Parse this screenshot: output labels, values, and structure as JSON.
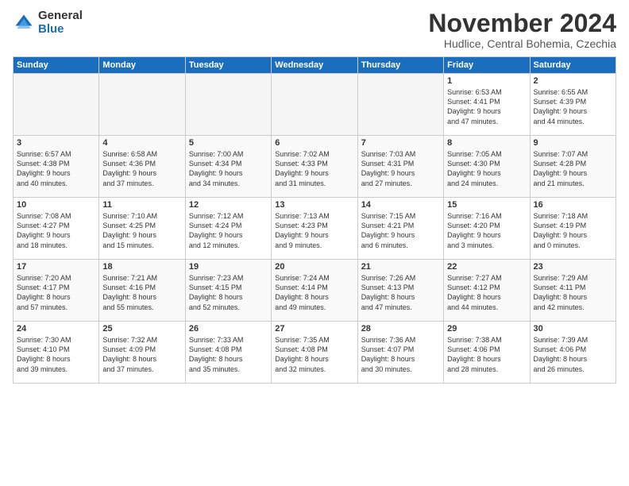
{
  "logo": {
    "general": "General",
    "blue": "Blue"
  },
  "title": "November 2024",
  "subtitle": "Hudlice, Central Bohemia, Czechia",
  "days_header": [
    "Sunday",
    "Monday",
    "Tuesday",
    "Wednesday",
    "Thursday",
    "Friday",
    "Saturday"
  ],
  "weeks": [
    [
      {
        "day": "",
        "info": ""
      },
      {
        "day": "",
        "info": ""
      },
      {
        "day": "",
        "info": ""
      },
      {
        "day": "",
        "info": ""
      },
      {
        "day": "",
        "info": ""
      },
      {
        "day": "1",
        "info": "Sunrise: 6:53 AM\nSunset: 4:41 PM\nDaylight: 9 hours\nand 47 minutes."
      },
      {
        "day": "2",
        "info": "Sunrise: 6:55 AM\nSunset: 4:39 PM\nDaylight: 9 hours\nand 44 minutes."
      }
    ],
    [
      {
        "day": "3",
        "info": "Sunrise: 6:57 AM\nSunset: 4:38 PM\nDaylight: 9 hours\nand 40 minutes."
      },
      {
        "day": "4",
        "info": "Sunrise: 6:58 AM\nSunset: 4:36 PM\nDaylight: 9 hours\nand 37 minutes."
      },
      {
        "day": "5",
        "info": "Sunrise: 7:00 AM\nSunset: 4:34 PM\nDaylight: 9 hours\nand 34 minutes."
      },
      {
        "day": "6",
        "info": "Sunrise: 7:02 AM\nSunset: 4:33 PM\nDaylight: 9 hours\nand 31 minutes."
      },
      {
        "day": "7",
        "info": "Sunrise: 7:03 AM\nSunset: 4:31 PM\nDaylight: 9 hours\nand 27 minutes."
      },
      {
        "day": "8",
        "info": "Sunrise: 7:05 AM\nSunset: 4:30 PM\nDaylight: 9 hours\nand 24 minutes."
      },
      {
        "day": "9",
        "info": "Sunrise: 7:07 AM\nSunset: 4:28 PM\nDaylight: 9 hours\nand 21 minutes."
      }
    ],
    [
      {
        "day": "10",
        "info": "Sunrise: 7:08 AM\nSunset: 4:27 PM\nDaylight: 9 hours\nand 18 minutes."
      },
      {
        "day": "11",
        "info": "Sunrise: 7:10 AM\nSunset: 4:25 PM\nDaylight: 9 hours\nand 15 minutes."
      },
      {
        "day": "12",
        "info": "Sunrise: 7:12 AM\nSunset: 4:24 PM\nDaylight: 9 hours\nand 12 minutes."
      },
      {
        "day": "13",
        "info": "Sunrise: 7:13 AM\nSunset: 4:23 PM\nDaylight: 9 hours\nand 9 minutes."
      },
      {
        "day": "14",
        "info": "Sunrise: 7:15 AM\nSunset: 4:21 PM\nDaylight: 9 hours\nand 6 minutes."
      },
      {
        "day": "15",
        "info": "Sunrise: 7:16 AM\nSunset: 4:20 PM\nDaylight: 9 hours\nand 3 minutes."
      },
      {
        "day": "16",
        "info": "Sunrise: 7:18 AM\nSunset: 4:19 PM\nDaylight: 9 hours\nand 0 minutes."
      }
    ],
    [
      {
        "day": "17",
        "info": "Sunrise: 7:20 AM\nSunset: 4:17 PM\nDaylight: 8 hours\nand 57 minutes."
      },
      {
        "day": "18",
        "info": "Sunrise: 7:21 AM\nSunset: 4:16 PM\nDaylight: 8 hours\nand 55 minutes."
      },
      {
        "day": "19",
        "info": "Sunrise: 7:23 AM\nSunset: 4:15 PM\nDaylight: 8 hours\nand 52 minutes."
      },
      {
        "day": "20",
        "info": "Sunrise: 7:24 AM\nSunset: 4:14 PM\nDaylight: 8 hours\nand 49 minutes."
      },
      {
        "day": "21",
        "info": "Sunrise: 7:26 AM\nSunset: 4:13 PM\nDaylight: 8 hours\nand 47 minutes."
      },
      {
        "day": "22",
        "info": "Sunrise: 7:27 AM\nSunset: 4:12 PM\nDaylight: 8 hours\nand 44 minutes."
      },
      {
        "day": "23",
        "info": "Sunrise: 7:29 AM\nSunset: 4:11 PM\nDaylight: 8 hours\nand 42 minutes."
      }
    ],
    [
      {
        "day": "24",
        "info": "Sunrise: 7:30 AM\nSunset: 4:10 PM\nDaylight: 8 hours\nand 39 minutes."
      },
      {
        "day": "25",
        "info": "Sunrise: 7:32 AM\nSunset: 4:09 PM\nDaylight: 8 hours\nand 37 minutes."
      },
      {
        "day": "26",
        "info": "Sunrise: 7:33 AM\nSunset: 4:08 PM\nDaylight: 8 hours\nand 35 minutes."
      },
      {
        "day": "27",
        "info": "Sunrise: 7:35 AM\nSunset: 4:08 PM\nDaylight: 8 hours\nand 32 minutes."
      },
      {
        "day": "28",
        "info": "Sunrise: 7:36 AM\nSunset: 4:07 PM\nDaylight: 8 hours\nand 30 minutes."
      },
      {
        "day": "29",
        "info": "Sunrise: 7:38 AM\nSunset: 4:06 PM\nDaylight: 8 hours\nand 28 minutes."
      },
      {
        "day": "30",
        "info": "Sunrise: 7:39 AM\nSunset: 4:06 PM\nDaylight: 8 hours\nand 26 minutes."
      }
    ]
  ]
}
